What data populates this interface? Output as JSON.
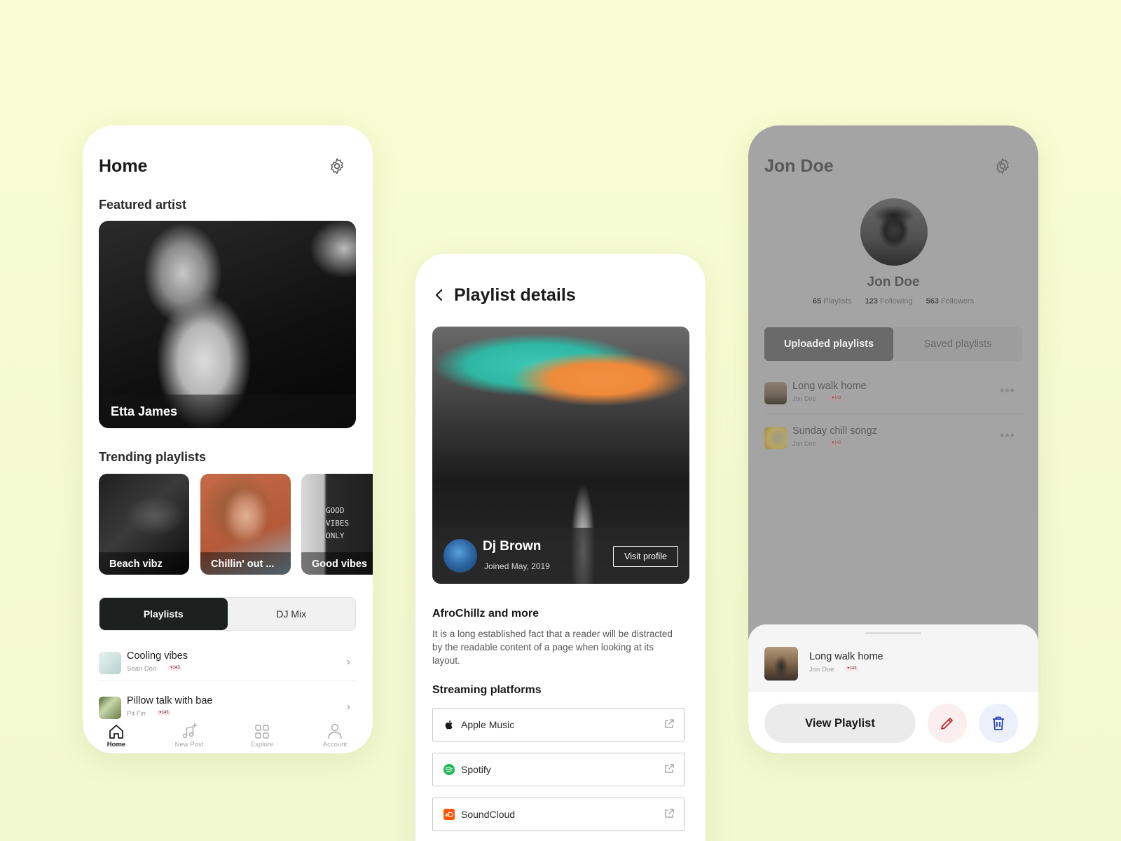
{
  "home": {
    "title": "Home",
    "featured_heading": "Featured artist",
    "featured_artist": "Etta James",
    "trending_heading": "Trending playlists",
    "trending": [
      {
        "label": "Beach vibz"
      },
      {
        "label": "Chillin' out ..."
      },
      {
        "label": "Good vibes",
        "image_text": [
          "GOOD",
          "VIBES",
          "ONLY"
        ]
      }
    ],
    "segment": {
      "active": "Playlists",
      "inactive": "DJ Mix"
    },
    "list": [
      {
        "title": "Cooling vibes",
        "author": "Sean Don",
        "likes": "143"
      },
      {
        "title": "Pillow talk with bae",
        "author": "Pit Fin",
        "likes": "143"
      }
    ],
    "tabs": [
      {
        "label": "Home",
        "icon": "home-icon"
      },
      {
        "label": "New Post",
        "icon": "music-note-plus-icon"
      },
      {
        "label": "Explore",
        "icon": "grid-icon"
      },
      {
        "label": "Account",
        "icon": "user-icon"
      }
    ]
  },
  "detail": {
    "title": "Playlist details",
    "dj_name": "Dj Brown",
    "joined": "Joined May, 2019",
    "visit_label": "Visit profile",
    "playlist_title": "AfroChillz and more",
    "description": "It is a long established fact that a reader will be distracted by the readable content of a page when looking at its layout.",
    "platforms_heading": "Streaming platforms",
    "platforms": [
      {
        "name": "Apple Music",
        "icon": "apple-icon"
      },
      {
        "name": "Spotify",
        "icon": "spotify-icon",
        "color": "#1db954"
      },
      {
        "name": "SoundCloud",
        "icon": "soundcloud-icon",
        "color": "#ff5500"
      }
    ]
  },
  "profile": {
    "title": "Jon Doe",
    "name": "Jon Doe",
    "stats": [
      {
        "value": "65",
        "label": "Playlists"
      },
      {
        "value": "123",
        "label": "Following"
      },
      {
        "value": "563",
        "label": "Followers"
      }
    ],
    "segment": {
      "active": "Uploaded playlists",
      "inactive": "Saved playlists"
    },
    "list": [
      {
        "title": "Long walk home",
        "author": "Jon Doe",
        "likes": "143"
      },
      {
        "title": "Sunday chill songz",
        "author": "Jon Doe",
        "likes": "143"
      }
    ],
    "sheet": {
      "title": "Long walk home",
      "author": "Jon Doe",
      "likes": "143",
      "view_label": "View Playlist"
    }
  },
  "colors": {
    "background": "#f8fdd3",
    "dark": "#1c2120",
    "edit": "#c0282d",
    "delete": "#2a3fb0"
  }
}
